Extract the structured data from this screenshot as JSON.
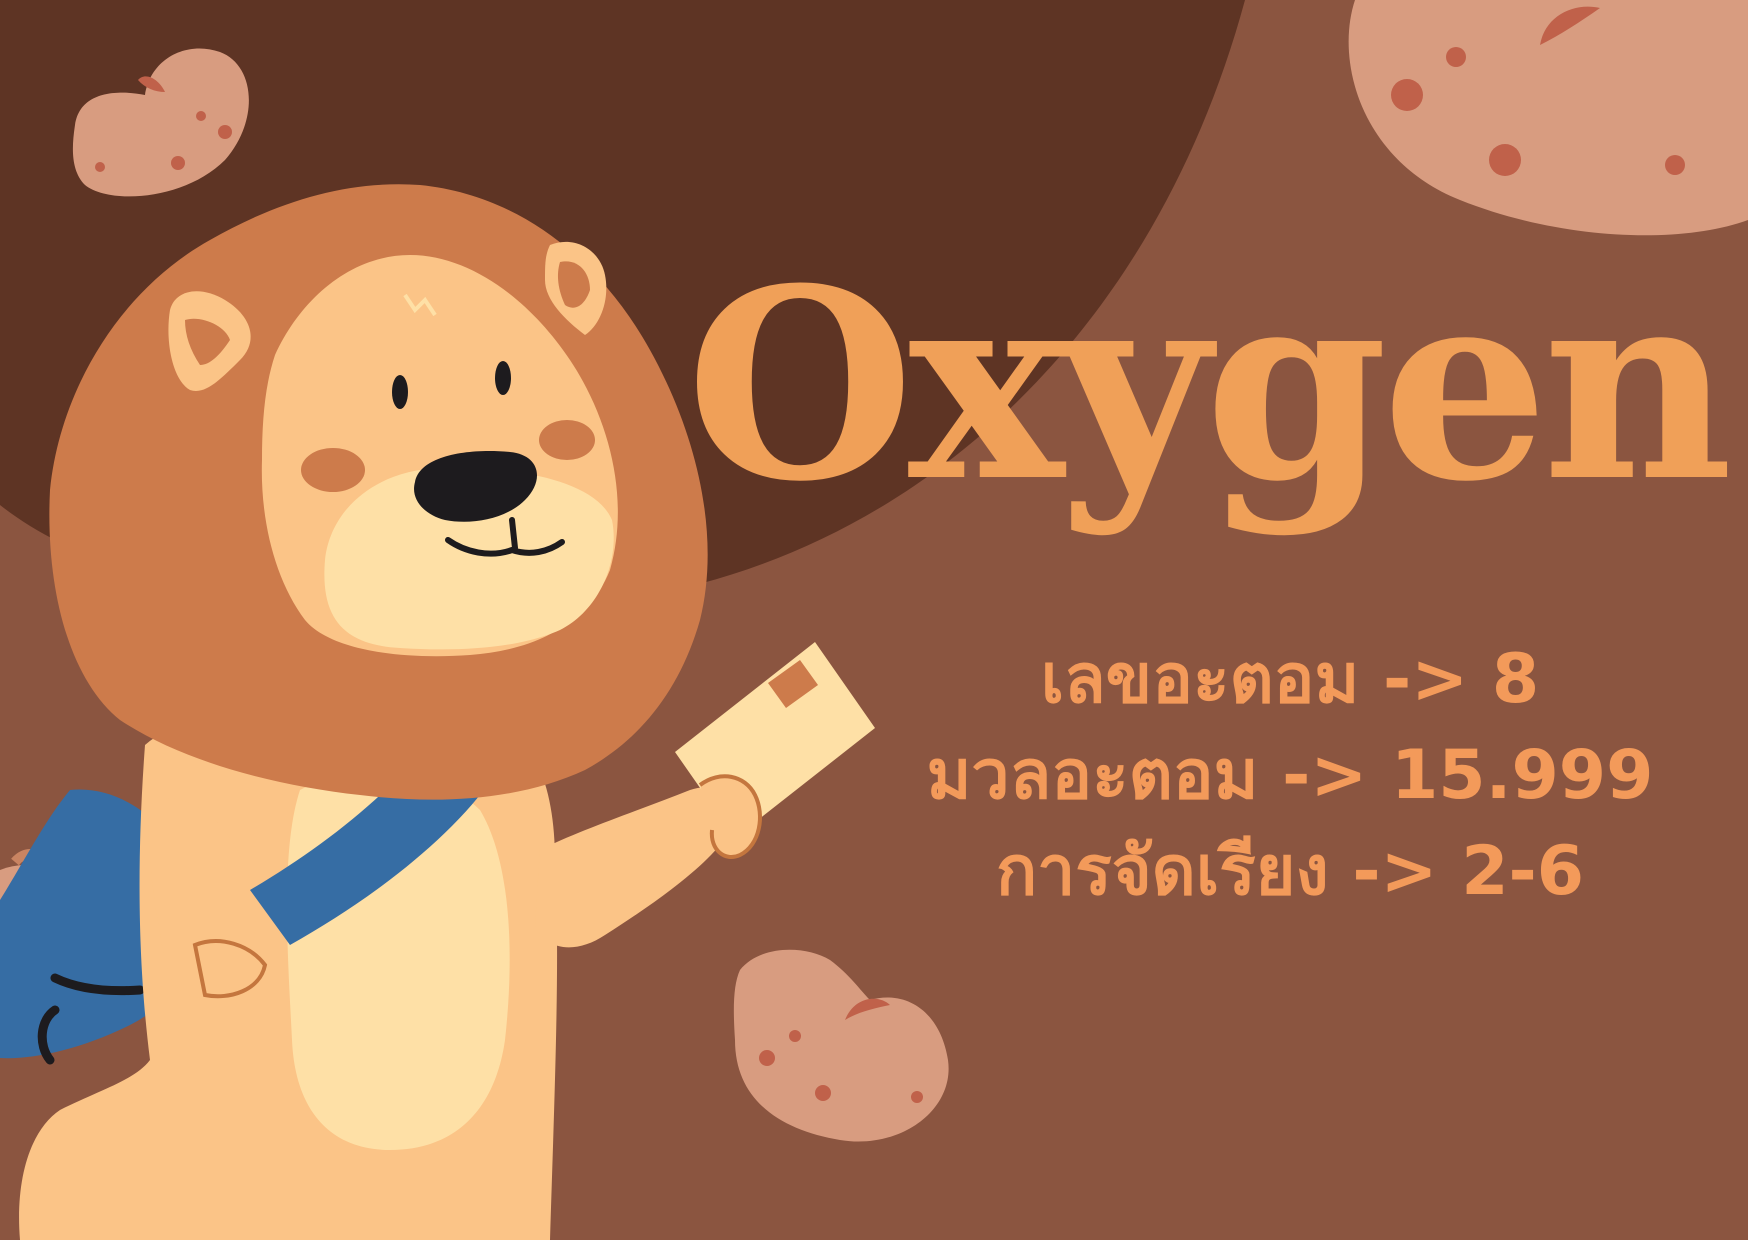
{
  "title": "Oxygen",
  "facts": [
    "เลขอะตอม -> 8",
    "มวลอะตอม -> 15.999",
    "การจัดเรียง -> 2-6"
  ],
  "colors": {
    "background": "#8b5540",
    "dark_blob": "#5e3424",
    "title": "#f0a058",
    "text": "#f39a5a",
    "potato": "#d89c80",
    "potato_spot": "#c0614a",
    "lion_mane": "#cd7b4b",
    "lion_fur": "#fbc487",
    "lion_belly": "#fee0a6",
    "bag": "#366da4"
  },
  "illustration": [
    "lion-character",
    "messenger-bag",
    "letter",
    "potato-decoration"
  ]
}
